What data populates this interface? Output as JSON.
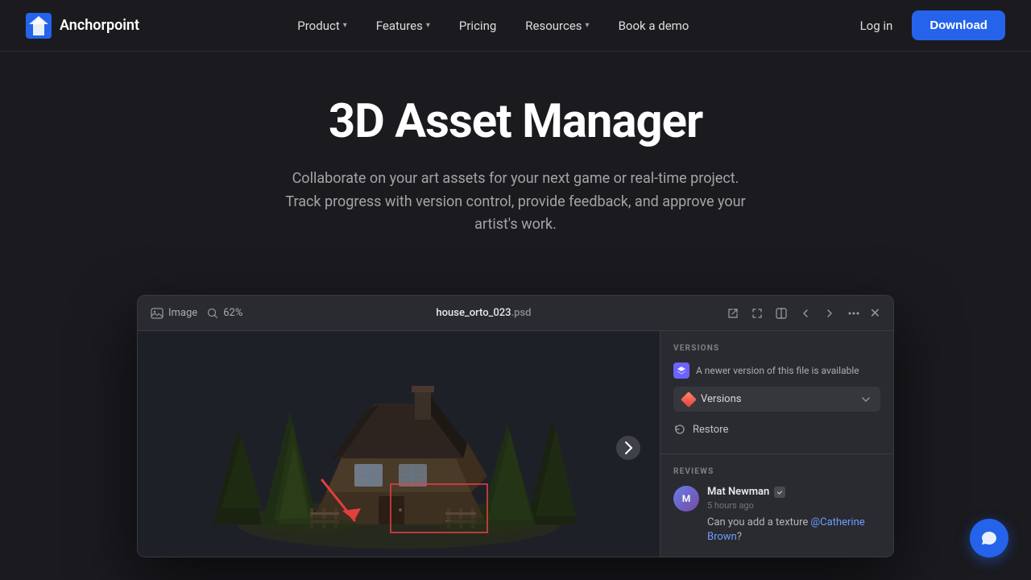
{
  "brand": {
    "name": "Anchorpoint",
    "logo_alt": "Anchorpoint logo"
  },
  "nav": {
    "links": [
      {
        "label": "Product",
        "has_dropdown": true
      },
      {
        "label": "Features",
        "has_dropdown": true
      },
      {
        "label": "Pricing",
        "has_dropdown": false
      },
      {
        "label": "Resources",
        "has_dropdown": true
      },
      {
        "label": "Book a demo",
        "has_dropdown": false
      }
    ],
    "login_label": "Log in",
    "download_label": "Download"
  },
  "hero": {
    "title": "3D Asset Manager",
    "subtitle": "Collaborate on your art assets for your next game or real-time project. Track progress with version control, provide feedback, and approve your artist's work."
  },
  "app_window": {
    "toolbar": {
      "type_label": "Image",
      "zoom_label": "62%",
      "filename": "house_orto_023",
      "extension": ".psd"
    },
    "versions_panel": {
      "section_label": "VERSIONS",
      "notice_text": "A newer version of this file is available",
      "dropdown_label": "Versions",
      "restore_label": "Restore"
    },
    "reviews_panel": {
      "section_label": "REVIEWS",
      "reviewer_name": "Mat Newman",
      "review_time": "5 hours ago",
      "review_text": "Can you add a texture @Catherine Brown?"
    }
  },
  "chat": {
    "icon": "chat-icon"
  }
}
